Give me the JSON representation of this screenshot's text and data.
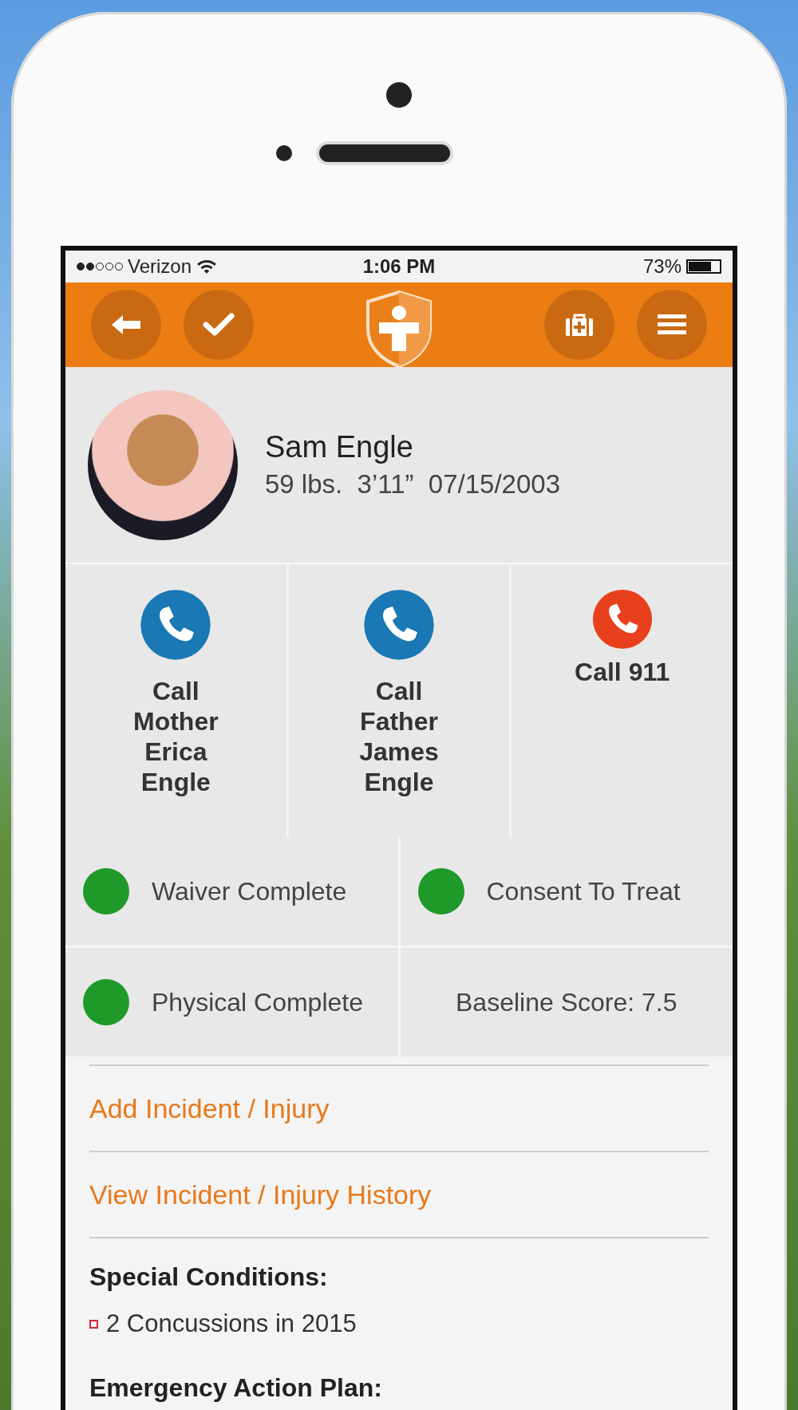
{
  "status_bar": {
    "carrier": "Verizon",
    "time": "1:06 PM",
    "battery": "73%",
    "level": 0.73
  },
  "toolbar": {
    "left_buttons": [
      {
        "kind": "back"
      },
      {
        "kind": "check"
      }
    ],
    "right_buttons": [
      {
        "kind": "first-aid"
      },
      {
        "kind": "menu"
      }
    ]
  },
  "profile": {
    "name": "Sam Engle",
    "details": "59 lbs.  3’11”  07/15/2003"
  },
  "calls": [
    {
      "label": "Call Mother Erica Engle",
      "color": "#1a78b4"
    },
    {
      "label": "Call Father James Engle",
      "color": "#1a78b4"
    },
    {
      "label": "Call 911",
      "color": "#e8401c"
    }
  ],
  "status_items": [
    {
      "kind": "status",
      "label": "Waiver Complete",
      "color": "#1f9a2a"
    },
    {
      "kind": "status",
      "label": "Consent To Treat",
      "color": "#1f9a2a"
    },
    {
      "kind": "status",
      "label": "Physical Complete",
      "color": "#1f9a2a"
    },
    {
      "kind": "score",
      "label": "Baseline Score: 7.5"
    }
  ],
  "links": [
    "Add Incident / Injury",
    "View Incident / Injury History"
  ],
  "special_conditions": {
    "heading": "Special Conditions:",
    "items": [
      "2 Concussions in 2015"
    ]
  },
  "emergency_action_plan": {
    "heading": "Emergency Action Plan:"
  }
}
